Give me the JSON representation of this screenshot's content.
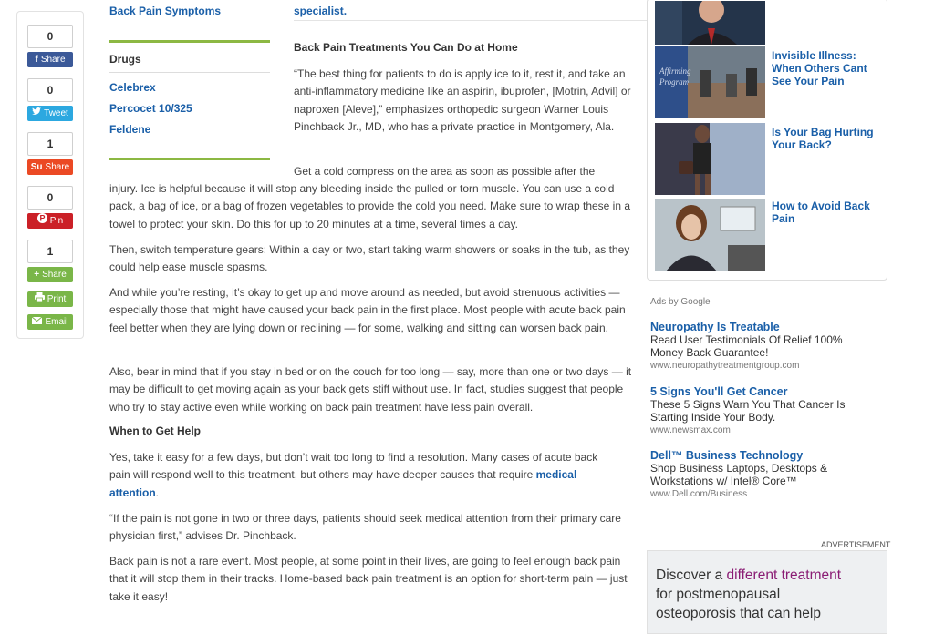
{
  "share": {
    "facebook": {
      "count": "0",
      "label": "Share"
    },
    "twitter": {
      "count": "0",
      "label": "Tweet"
    },
    "stumbleupon": {
      "count": "1",
      "label": "Share"
    },
    "pinterest": {
      "count": "0",
      "label": "Pin"
    },
    "more": {
      "count": "1",
      "label": "Share"
    },
    "print_label": "Print",
    "email_label": "Email"
  },
  "leftnav": {
    "top_link": "Back Pain Symptoms",
    "drugs_heading": "Drugs",
    "drugs": [
      "Celebrex",
      "Percocet 10/325",
      "Feldene"
    ]
  },
  "article": {
    "top_link": "specialist.",
    "heading1": "Back Pain Treatments You Can Do at Home",
    "p1": "“The best thing for patients to do is apply ice to it, rest it, and take an anti-inflammatory medicine like an aspirin, ibuprofen, [Motrin, Advil] or naproxen [Aleve],” emphasizes orthopedic surgeon Warner Louis Pinchback Jr., MD, who has a private practice in Montgomery, Ala.",
    "p2_first": "Get a cold compress on the area as soon as possible after the",
    "p2_rest": "injury. Ice is helpful because it will stop any bleeding inside the pulled or torn muscle. You can use a cold pack, a bag of ice, or a bag of frozen vegetables to provide the cold you need. Make sure to wrap these in a towel to protect your skin. Do this for up to 20 minutes at a time, several times a day.",
    "p3": "Then, switch temperature gears: Within a day or two, start taking warm showers or soaks in the tub, as they could help ease muscle spasms.",
    "p4": "And while you’re resting, it’s okay to get up and move around as needed, but avoid strenuous activities — especially those that might have caused your back pain in the first place. Most people with acute back pain feel better when they are lying down or reclining — for some, walking and sitting can worsen back pain.",
    "p5": "Also, bear in mind that if you stay in bed or on the couch for too long — say, more than one or two days — it may be difficult to get moving again as your back gets stiff without use. In fact, studies suggest that people who try to stay active even while working on back pain treatment have less pain overall.",
    "heading2": "When to Get Help",
    "p6_before": "Yes, take it easy for a few days, but don’t wait too long to find a resolution. Many cases of acute back pain will respond well to this treatment, but others may have deeper causes that require ",
    "p6_link": "medical attention",
    "p6_after": ".",
    "p7": "“If the pain is not gone in two or three days, patients should seek medical attention from their primary care physician first,” advises Dr. Pinchback.",
    "p8": "Back pain is not a rare event. Most people, at some point in their lives, are going to feel enough back pain that it will stop them in their tracks. Home-based back pain treatment is an option for short-term pain — just take it easy!"
  },
  "videos": [
    {
      "title": "Invisible Illness: When Others Cant See Your Pain"
    },
    {
      "title": "Is Your Bag Hurting Your Back?"
    },
    {
      "title": "How to Avoid Back Pain"
    }
  ],
  "ads": {
    "label": "Ads by Google",
    "items": [
      {
        "title": "Neuropathy Is Treatable",
        "text": "Read User Testimonials Of Relief 100% Money Back Guarantee!",
        "url": "www.neuropathytreatmentgroup.com"
      },
      {
        "title": "5 Signs You'll Get Cancer",
        "text": "These 5 Signs Warn You That Cancer Is Starting Inside Your Body.",
        "url": "www.newsmax.com"
      },
      {
        "title": "Dell™ Business Technology",
        "text": "Shop Business Laptops, Desktops & Workstations w/ Intel® Core™",
        "url": "www.Dell.com/Business"
      }
    ]
  },
  "advertisement": {
    "label": "ADVERTISEMENT",
    "line1_a": "Discover a ",
    "line1_b": "different treatment",
    "line2": "for postmenopausal",
    "line3": "osteoporosis that can help"
  },
  "colors": {
    "link": "#1a5fa8",
    "accent_green": "#8cb843",
    "ad_purple": "#8a1c74"
  }
}
